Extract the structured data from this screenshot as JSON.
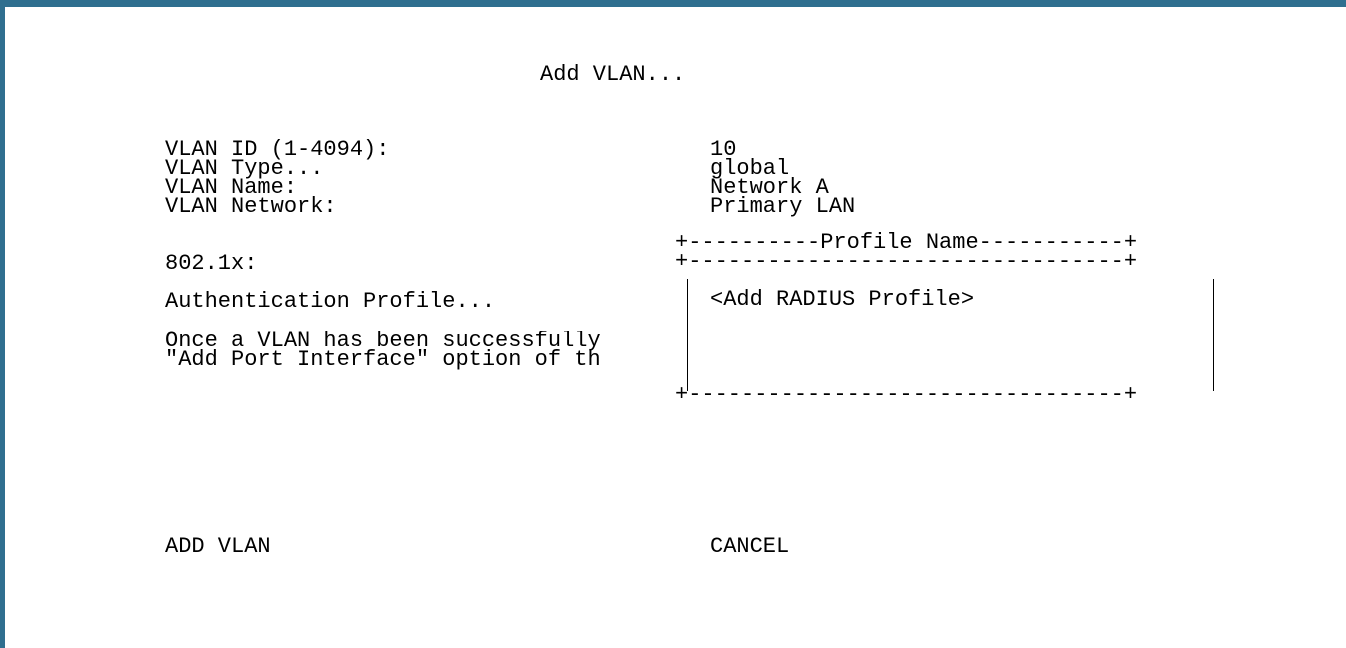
{
  "dialog": {
    "title": "Add VLAN..."
  },
  "fields": [
    {
      "label": "VLAN ID (1-4094):",
      "value": "10"
    },
    {
      "label": "VLAN Type...",
      "value": "global"
    },
    {
      "label": "VLAN Name:",
      "value": "Network A"
    },
    {
      "label": "VLAN Network:",
      "value": "Primary LAN"
    }
  ],
  "dot1x": {
    "section_label": "802.1x:",
    "auth_profile_label": "Authentication Profile..."
  },
  "note": {
    "line1": "Once a VLAN has been successfully",
    "line2": "\"Add Port Interface\" option of th"
  },
  "profile_popup": {
    "top_border": "+----------Profile Name-----------+",
    "separator": "+---------------------------------+",
    "bottom_border": "+---------------------------------+",
    "items": [
      "<Add RADIUS Profile>"
    ]
  },
  "buttons": {
    "add_label": "ADD VLAN",
    "cancel_label": "CANCEL"
  }
}
